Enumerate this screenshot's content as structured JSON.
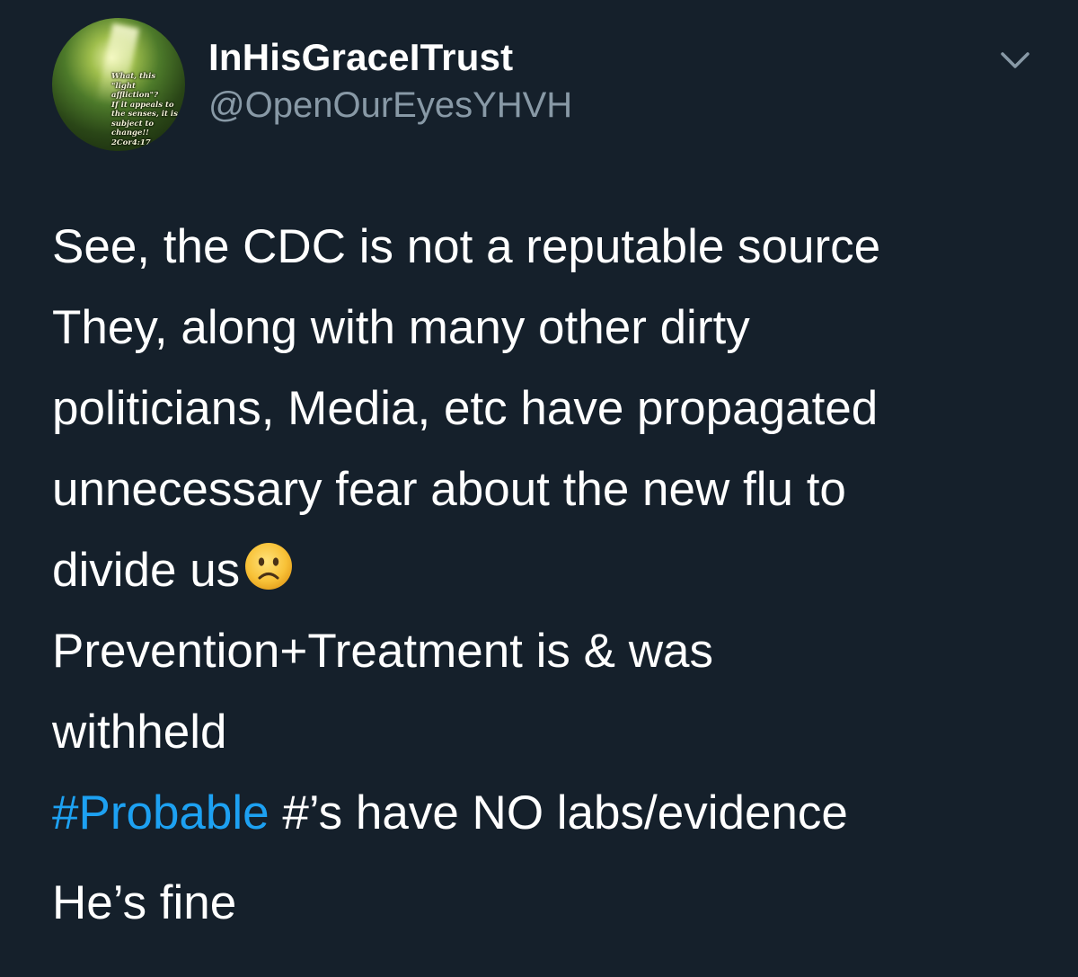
{
  "author": {
    "display_name": "InHisGraceITrust",
    "handle": "@OpenOurEyesYHVH",
    "avatar_quote": "What, this\n\"light affliction\"?\nIf it appeals to\nthe senses, it is\nsubject to\nchange!!\n2Cor4:17"
  },
  "menu": {
    "icon": "chevron-down-icon"
  },
  "tweet": {
    "line1": "See, the CDC is not a reputable source",
    "line2": "They, along with many other dirty",
    "line3": "politicians, Media, etc have propagated",
    "line4": "unnecessary fear about the new flu to",
    "line5": "divide us",
    "line5_emoji": "slightly-frowning-face-emoji",
    "line6": "Prevention+Treatment is & was",
    "line7": "withheld",
    "hashtag": "#Probable",
    "line8_rest": " #’s have NO labs/evidence",
    "line9": "He’s fine"
  },
  "colors": {
    "background": "#15202b",
    "text": "#ffffff",
    "secondary_text": "#8899a6",
    "link": "#1da1f2"
  }
}
